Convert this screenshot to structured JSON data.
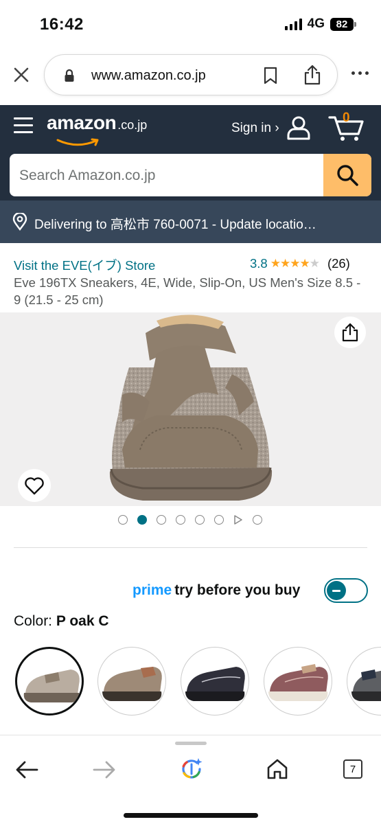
{
  "status_bar": {
    "time": "16:42",
    "network": "4G",
    "battery": "82"
  },
  "browser": {
    "url": "www.amazon.co.jp"
  },
  "header": {
    "logo_word": "amazon",
    "logo_tld": ".co.jp",
    "sign_in": "Sign in ›",
    "cart_count": "0",
    "search_placeholder": "Search Amazon.co.jp",
    "delivery": "Delivering to 高松市 760-0071 - Update locatio…"
  },
  "product": {
    "store_link": "Visit the EVE(イブ) Store",
    "rating": "3.8",
    "rating_value": 3.8,
    "review_count": "(26)",
    "title": "Eve 196TX Sneakers, 4E, Wide, Slip-On, US Men's Size 8.5 - 9 (21.5 - 25 cm)",
    "image_count": 7,
    "active_image_index": 1
  },
  "prime": {
    "brand": "prime",
    "tagline": "try before you buy"
  },
  "color": {
    "label": "Color:",
    "selected": "P oak C"
  },
  "swatch_colors": [
    "#b9ada0",
    "#9e8a77",
    "#2f2f3a",
    "#8f5b5e",
    "#5d5f63"
  ],
  "tabs_count": "7",
  "colors": {
    "amazon_dark": "#232f3e",
    "delivery_bar": "#37475a",
    "link": "#007185",
    "search_button": "#febd69",
    "prime_blue": "#1399ff",
    "star": "#ffa41c"
  }
}
